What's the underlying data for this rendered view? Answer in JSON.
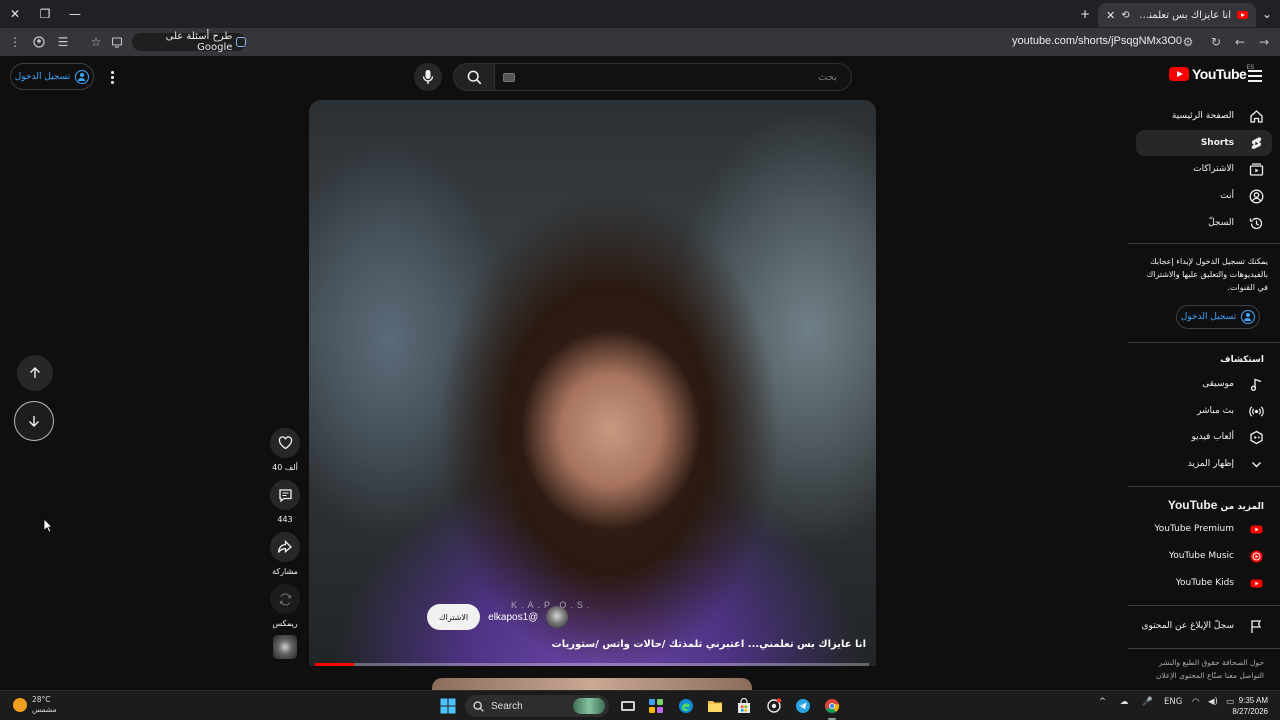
{
  "browser": {
    "tab_title": "انا عايزاك بس تعلمني.. اعتبر",
    "url": "youtube.com/shorts/jPsqgNMx3O0",
    "ask_google": "طرح أسئلة على Google"
  },
  "header": {
    "logo_text": "YouTube",
    "region": "ES",
    "search_placeholder": "بحث",
    "signin_label": "تسجيل الدخول"
  },
  "sidebar": {
    "nav": [
      {
        "label": "الصفحة الرئيسية",
        "icon": "home-icon"
      },
      {
        "label": "Shorts",
        "icon": "shorts-icon",
        "active": true
      },
      {
        "label": "الاشتراكات",
        "icon": "subscriptions-icon"
      },
      {
        "label": "أنت",
        "icon": "you-icon"
      },
      {
        "label": "السجلّ",
        "icon": "history-icon"
      }
    ],
    "signin_prompt": "يمكنك تسجيل الدخول لإبداء إعجابك بالفيديوهات والتعليق عليها والاشتراك في القنوات.",
    "signin_label": "تسجيل الدخول",
    "explore_title": "استكشاف",
    "explore": [
      {
        "label": "موسيقى",
        "icon": "music-icon"
      },
      {
        "label": "بث مباشر",
        "icon": "live-icon"
      },
      {
        "label": "ألعاب فيديو",
        "icon": "gaming-icon"
      },
      {
        "label": "إظهار المزيد",
        "icon": "chevron-down-icon"
      }
    ],
    "more_title_prefix": "المزيد من",
    "more_title_brand": "YouTube",
    "more": [
      {
        "label": "YouTube Premium",
        "icon": "youtube-premium-icon"
      },
      {
        "label": "YouTube Music",
        "icon": "youtube-music-icon"
      },
      {
        "label": "YouTube Kids",
        "icon": "youtube-kids-icon"
      }
    ],
    "report_label": "سجلّ الإبلاغ عن المحتوى",
    "footer": "حول الصحافة حقوق الطبع والنشر التواصل معنا صنّاع المحتوى الإعلان"
  },
  "video": {
    "watermark": "K.A.P.O.S.",
    "handle": "@elkapos1",
    "subscribe_label": "الاشتراك",
    "title": "انا عايزاك بس تعلمني... اعتبرني تلمذتك /حالات واتس /ستوريات انستا...",
    "progress": 0.07
  },
  "actions": {
    "likes": "40 ألف",
    "comments": "443",
    "share": "مشاركة",
    "remix": "ريمكس"
  },
  "taskbar": {
    "temp": "28°C",
    "weather": "مشمس",
    "search": "Search",
    "lang": "ENG",
    "time": "9:35 AM",
    "date": "8/27/2026"
  }
}
